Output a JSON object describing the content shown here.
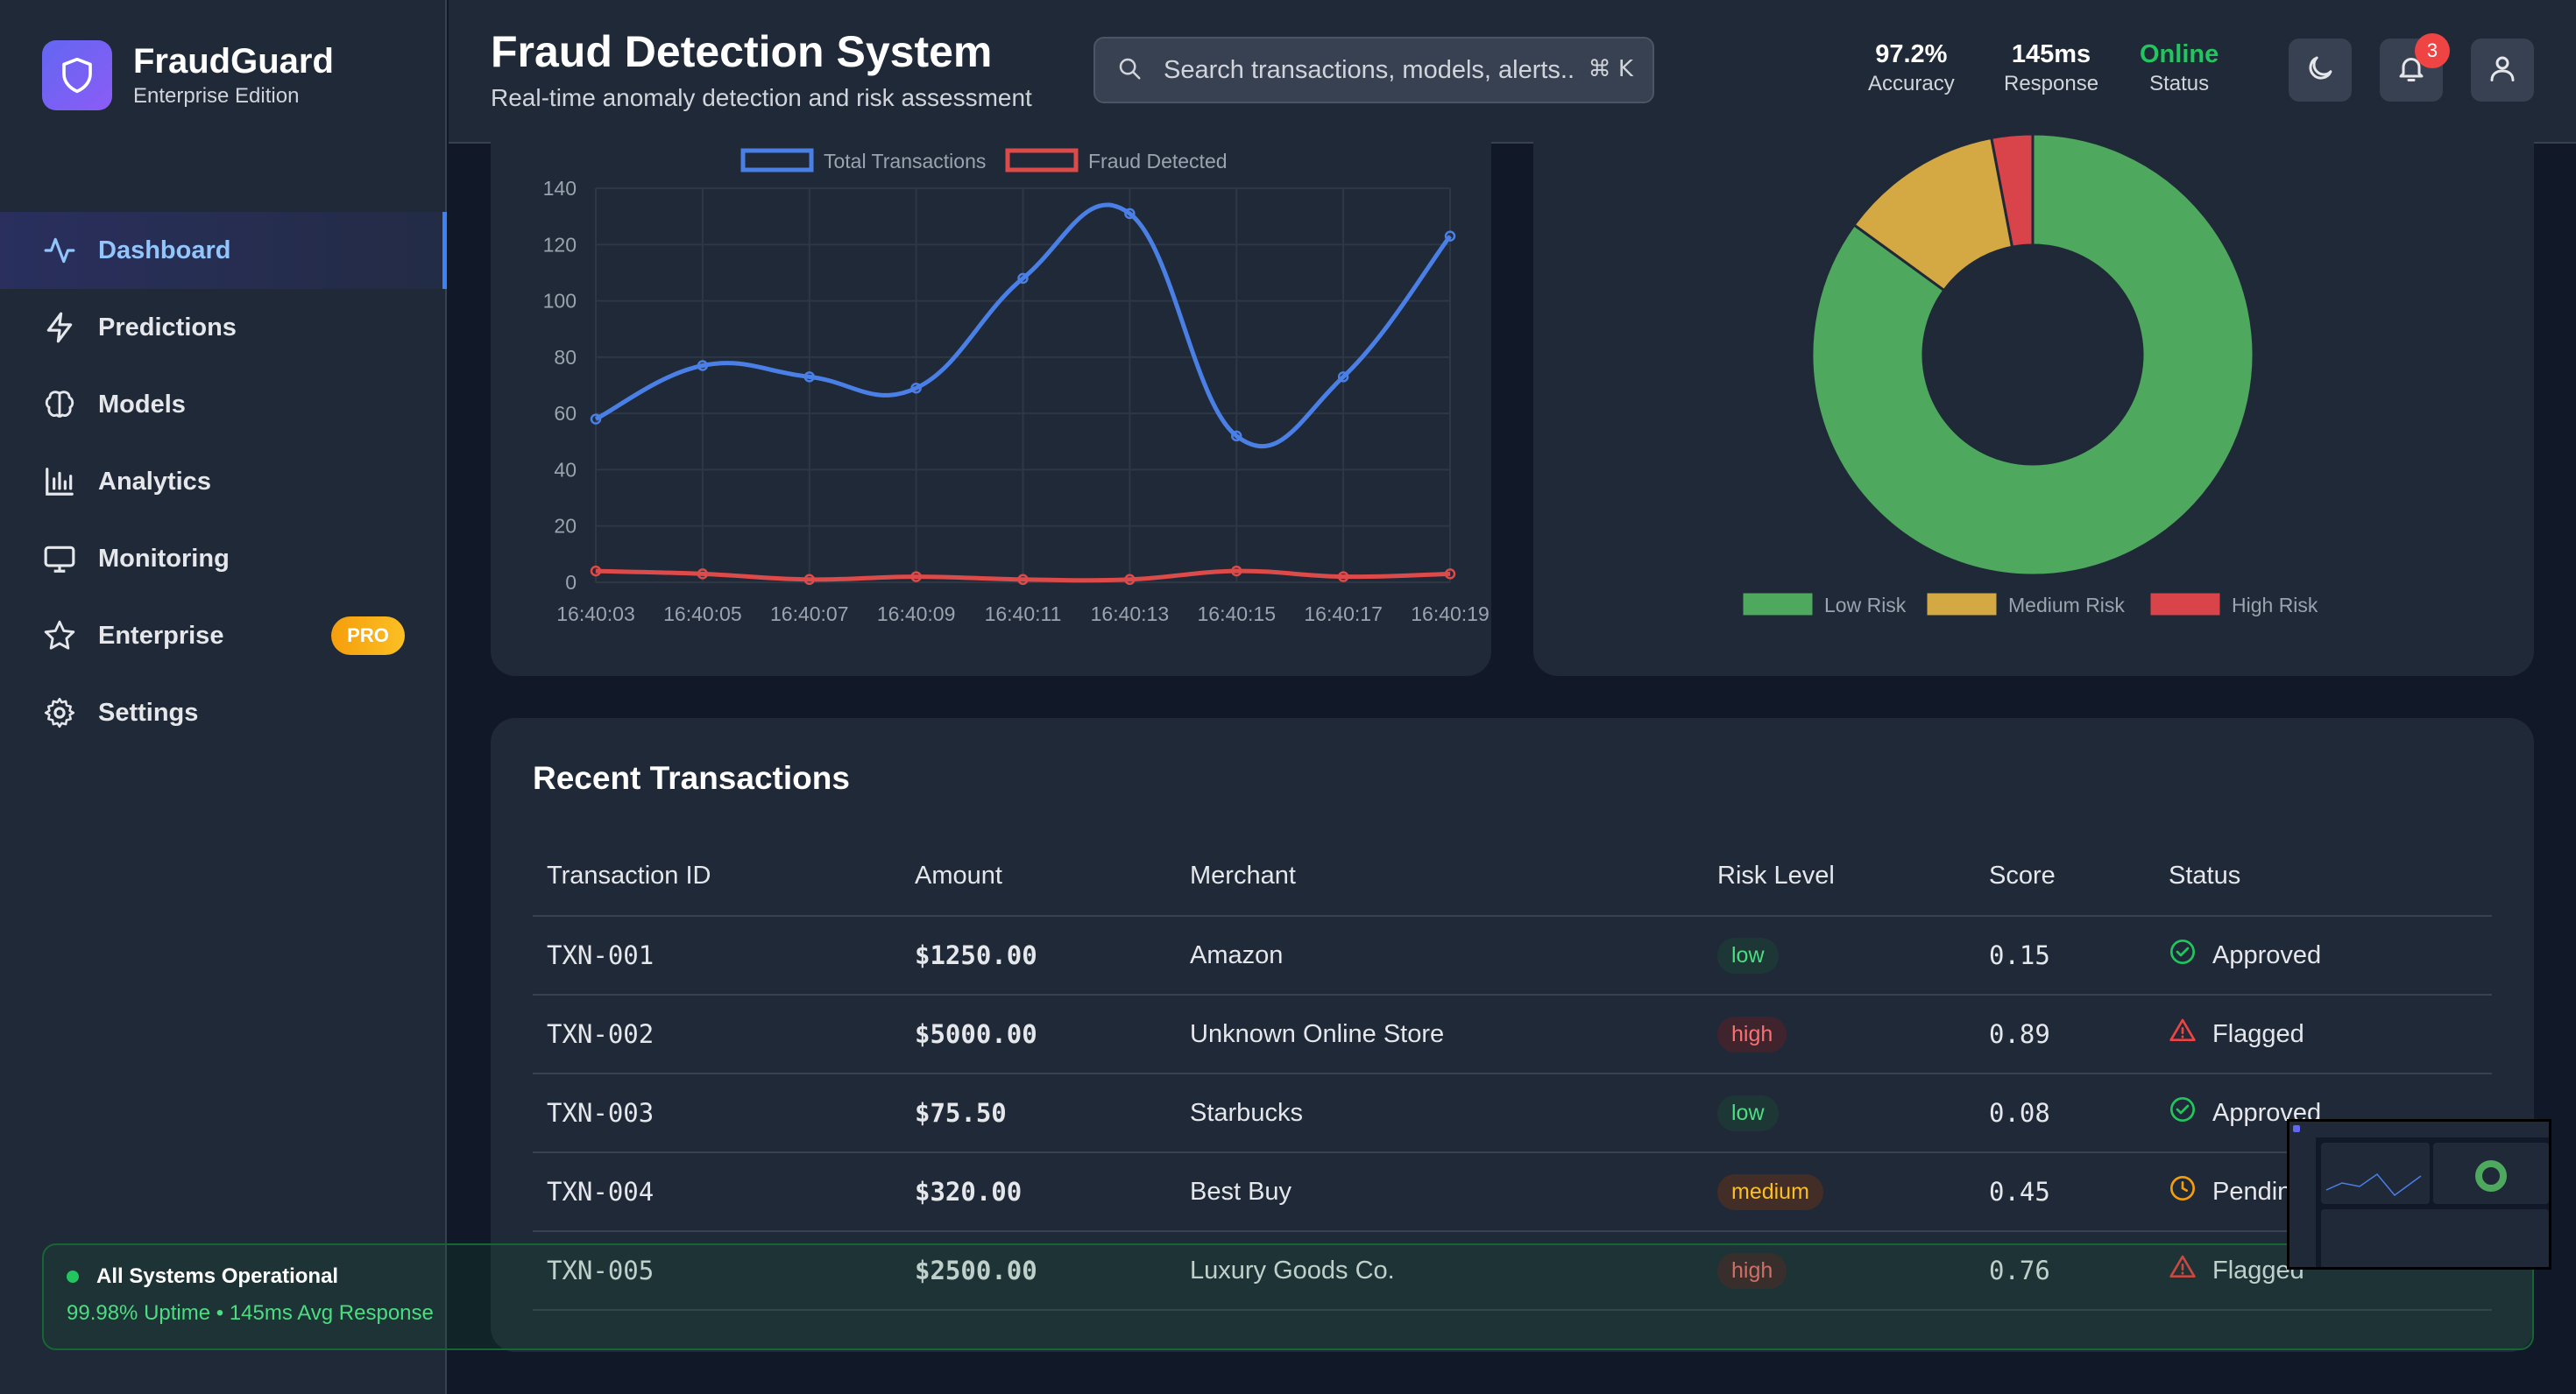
{
  "brand": {
    "name": "FraudGuard",
    "edition": "Enterprise Edition"
  },
  "sidebar": {
    "items": [
      {
        "label": "Dashboard",
        "icon": "activity-icon",
        "active": true
      },
      {
        "label": "Predictions",
        "icon": "lightning-icon"
      },
      {
        "label": "Models",
        "icon": "brain-icon"
      },
      {
        "label": "Analytics",
        "icon": "bar-chart-icon"
      },
      {
        "label": "Monitoring",
        "icon": "monitor-icon"
      },
      {
        "label": "Enterprise",
        "icon": "star-icon",
        "badge": "PRO"
      },
      {
        "label": "Settings",
        "icon": "gear-icon"
      }
    ],
    "status": {
      "title": "All Systems Operational",
      "detail": "99.98% Uptime • 145ms Avg Response"
    }
  },
  "header": {
    "title": "Fraud Detection System",
    "subtitle": "Real-time anomaly detection and risk assessment",
    "search_placeholder": "Search transactions, models, alerts...",
    "shortcut": "⌘ K",
    "metrics": [
      {
        "value": "97.2%",
        "label": "Accuracy"
      },
      {
        "value": "145ms",
        "label": "Response"
      },
      {
        "value": "Online",
        "label": "Status"
      }
    ],
    "notification_count": "3"
  },
  "colors": {
    "accent": "#3b82f6",
    "low": "#4ea85e",
    "medium": "#d4a843",
    "high": "#d9434a",
    "fraud": "#dc4a4a"
  },
  "chart_data": [
    {
      "type": "line",
      "x": [
        "16:40:03",
        "16:40:05",
        "16:40:07",
        "16:40:09",
        "16:40:11",
        "16:40:13",
        "16:40:15",
        "16:40:17",
        "16:40:19"
      ],
      "yticks": [
        "0",
        "20",
        "40",
        "60",
        "80",
        "100",
        "120",
        "140"
      ],
      "ylim": [
        0,
        140
      ],
      "series": [
        {
          "name": "Total Transactions",
          "color": "#4a7fe6",
          "values": [
            58,
            77,
            73,
            69,
            108,
            131,
            52,
            73,
            123
          ]
        },
        {
          "name": "Fraud Detected",
          "color": "#dc4a4a",
          "values": [
            4,
            3,
            1,
            2,
            1,
            1,
            4,
            2,
            3
          ]
        }
      ],
      "grid": true,
      "legend": "top"
    },
    {
      "type": "pie",
      "labels": [
        "Low Risk",
        "Medium Risk",
        "High Risk"
      ],
      "values": [
        85,
        12,
        3
      ],
      "colors": [
        "#4ea85e",
        "#d4a843",
        "#d9434a"
      ],
      "donut": true,
      "legend": "bottom"
    }
  ],
  "transactions": {
    "title": "Recent Transactions",
    "columns": [
      "Transaction ID",
      "Amount",
      "Merchant",
      "Risk Level",
      "Score",
      "Status"
    ],
    "rows": [
      {
        "id": "TXN-001",
        "amount": "$1250.00",
        "merchant": "Amazon",
        "risk": "low",
        "score": "0.15",
        "status": "Approved",
        "status_icon": "check-circle-icon"
      },
      {
        "id": "TXN-002",
        "amount": "$5000.00",
        "merchant": "Unknown Online Store",
        "risk": "high",
        "score": "0.89",
        "status": "Flagged",
        "status_icon": "warning-icon"
      },
      {
        "id": "TXN-003",
        "amount": "$75.50",
        "merchant": "Starbucks",
        "risk": "low",
        "score": "0.08",
        "status": "Approved",
        "status_icon": "check-circle-icon"
      },
      {
        "id": "TXN-004",
        "amount": "$320.00",
        "merchant": "Best Buy",
        "risk": "medium",
        "score": "0.45",
        "status": "Pending",
        "status_icon": "clock-icon"
      },
      {
        "id": "TXN-005",
        "amount": "$2500.00",
        "merchant": "Luxury Goods Co.",
        "risk": "high",
        "score": "0.76",
        "status": "Flagged",
        "status_icon": "warning-icon"
      }
    ]
  }
}
